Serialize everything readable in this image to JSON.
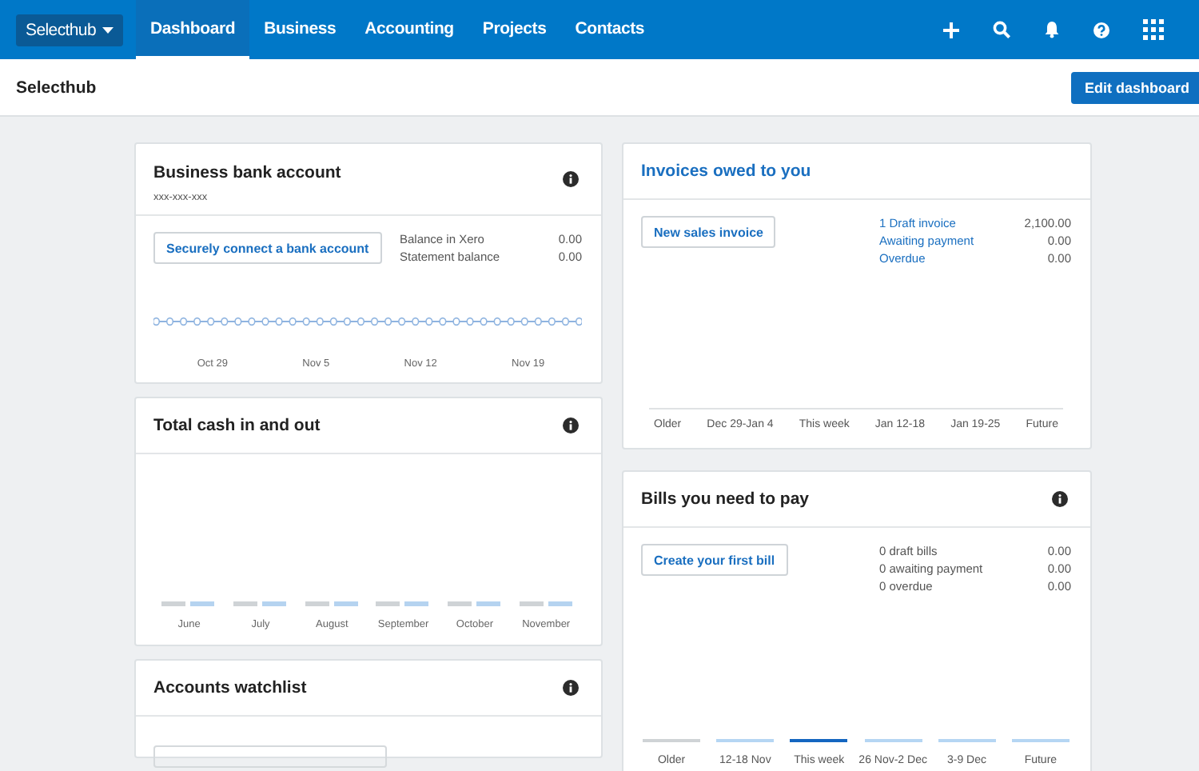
{
  "nav": {
    "org": "Selecthub",
    "tabs": [
      {
        "label": "Dashboard",
        "selected": true
      },
      {
        "label": "Business",
        "selected": false
      },
      {
        "label": "Accounting",
        "selected": false
      },
      {
        "label": "Projects",
        "selected": false
      },
      {
        "label": "Contacts",
        "selected": false
      }
    ]
  },
  "subheader": {
    "title": "Selecthub",
    "button": "Edit dashboard"
  },
  "bank_account": {
    "title": "Business bank account",
    "number": "xxx-xxx-xxx",
    "button": "Securely connect a bank account",
    "rows": [
      {
        "label": "Balance in Xero",
        "value": "0.00"
      },
      {
        "label": "Statement balance",
        "value": "0.00"
      }
    ],
    "x_labels": [
      "Oct 29",
      "Nov 5",
      "Nov 12",
      "Nov 19"
    ]
  },
  "cash": {
    "title": "Total cash in and out",
    "months": [
      "June",
      "July",
      "August",
      "September",
      "October",
      "November"
    ]
  },
  "watchlist": {
    "title": "Accounts watchlist"
  },
  "invoices": {
    "title": "Invoices owed to you",
    "button": "New sales invoice",
    "rows": [
      {
        "label": "1 Draft invoice",
        "value": "2,100.00"
      },
      {
        "label": "Awaiting payment",
        "value": "0.00"
      },
      {
        "label": "Overdue",
        "value": "0.00"
      }
    ],
    "periods": [
      "Older",
      "Dec 29-Jan 4",
      "This week",
      "Jan 12-18",
      "Jan 19-25",
      "Future"
    ]
  },
  "bills": {
    "title": "Bills you need to pay",
    "button": "Create your first bill",
    "rows": [
      {
        "label": "0 draft bills",
        "value": "0.00"
      },
      {
        "label": "0 awaiting payment",
        "value": "0.00"
      },
      {
        "label": "0 overdue",
        "value": "0.00"
      }
    ],
    "periods": [
      {
        "label": "Older",
        "selected": false
      },
      {
        "label": "12-18 Nov",
        "selected": false
      },
      {
        "label": "This week",
        "selected": true
      },
      {
        "label": "26 Nov-2 Dec",
        "selected": false
      },
      {
        "label": "3-9 Dec",
        "selected": false
      },
      {
        "label": "Future",
        "selected": false
      }
    ]
  }
}
